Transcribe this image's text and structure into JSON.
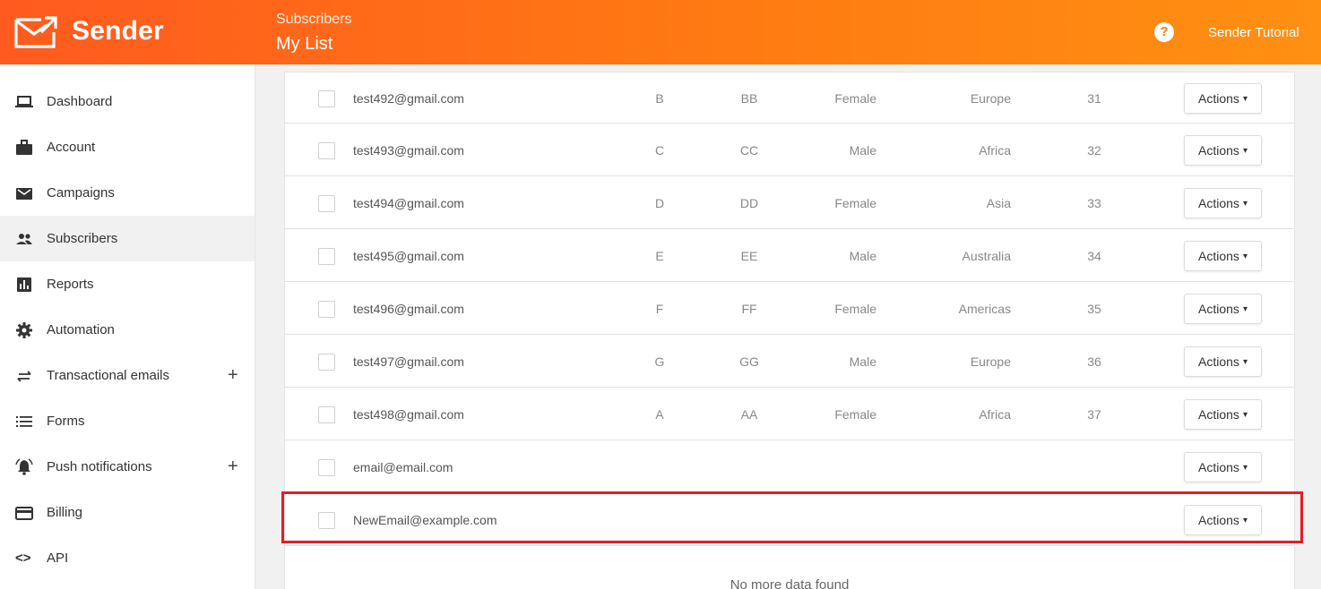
{
  "header": {
    "logo_text": "Sender",
    "section": "Subscribers",
    "title": "My List",
    "help_icon": "?",
    "user": "Sender Tutorial",
    "colors": {
      "gradient_start": "#ff5a1f",
      "gradient_end": "#ff9012"
    }
  },
  "sidebar": {
    "items": [
      {
        "label": "Dashboard",
        "icon": "laptop-icon"
      },
      {
        "label": "Account",
        "icon": "briefcase-icon"
      },
      {
        "label": "Campaigns",
        "icon": "envelope-icon"
      },
      {
        "label": "Subscribers",
        "icon": "people-icon",
        "active": true
      },
      {
        "label": "Reports",
        "icon": "bar-chart-icon"
      },
      {
        "label": "Automation",
        "icon": "gear-icon"
      },
      {
        "label": "Transactional emails",
        "icon": "swap-arrows-icon",
        "expand": "+"
      },
      {
        "label": "Forms",
        "icon": "list-icon"
      },
      {
        "label": "Push notifications",
        "icon": "bell-icon",
        "expand": "+"
      },
      {
        "label": "Billing",
        "icon": "credit-card-icon"
      },
      {
        "label": "API",
        "icon": "code-icon",
        "glyph": "<>"
      }
    ]
  },
  "table": {
    "action_label": "Actions",
    "rows": [
      {
        "email": "test492@gmail.com",
        "c1": "B",
        "c2": "BB",
        "gender": "Female",
        "region": "Europe",
        "num": "31"
      },
      {
        "email": "test493@gmail.com",
        "c1": "C",
        "c2": "CC",
        "gender": "Male",
        "region": "Africa",
        "num": "32"
      },
      {
        "email": "test494@gmail.com",
        "c1": "D",
        "c2": "DD",
        "gender": "Female",
        "region": "Asia",
        "num": "33"
      },
      {
        "email": "test495@gmail.com",
        "c1": "E",
        "c2": "EE",
        "gender": "Male",
        "region": "Australia",
        "num": "34"
      },
      {
        "email": "test496@gmail.com",
        "c1": "F",
        "c2": "FF",
        "gender": "Female",
        "region": "Americas",
        "num": "35"
      },
      {
        "email": "test497@gmail.com",
        "c1": "G",
        "c2": "GG",
        "gender": "Male",
        "region": "Europe",
        "num": "36"
      },
      {
        "email": "test498@gmail.com",
        "c1": "A",
        "c2": "AA",
        "gender": "Female",
        "region": "Africa",
        "num": "37"
      },
      {
        "email": "email@email.com",
        "c1": "",
        "c2": "",
        "gender": "",
        "region": "",
        "num": ""
      },
      {
        "email": "NewEmail@example.com",
        "c1": "",
        "c2": "",
        "gender": "",
        "region": "",
        "num": "",
        "highlighted": true
      }
    ],
    "footer": "No more data found",
    "highlight_color": "#e31e24"
  }
}
